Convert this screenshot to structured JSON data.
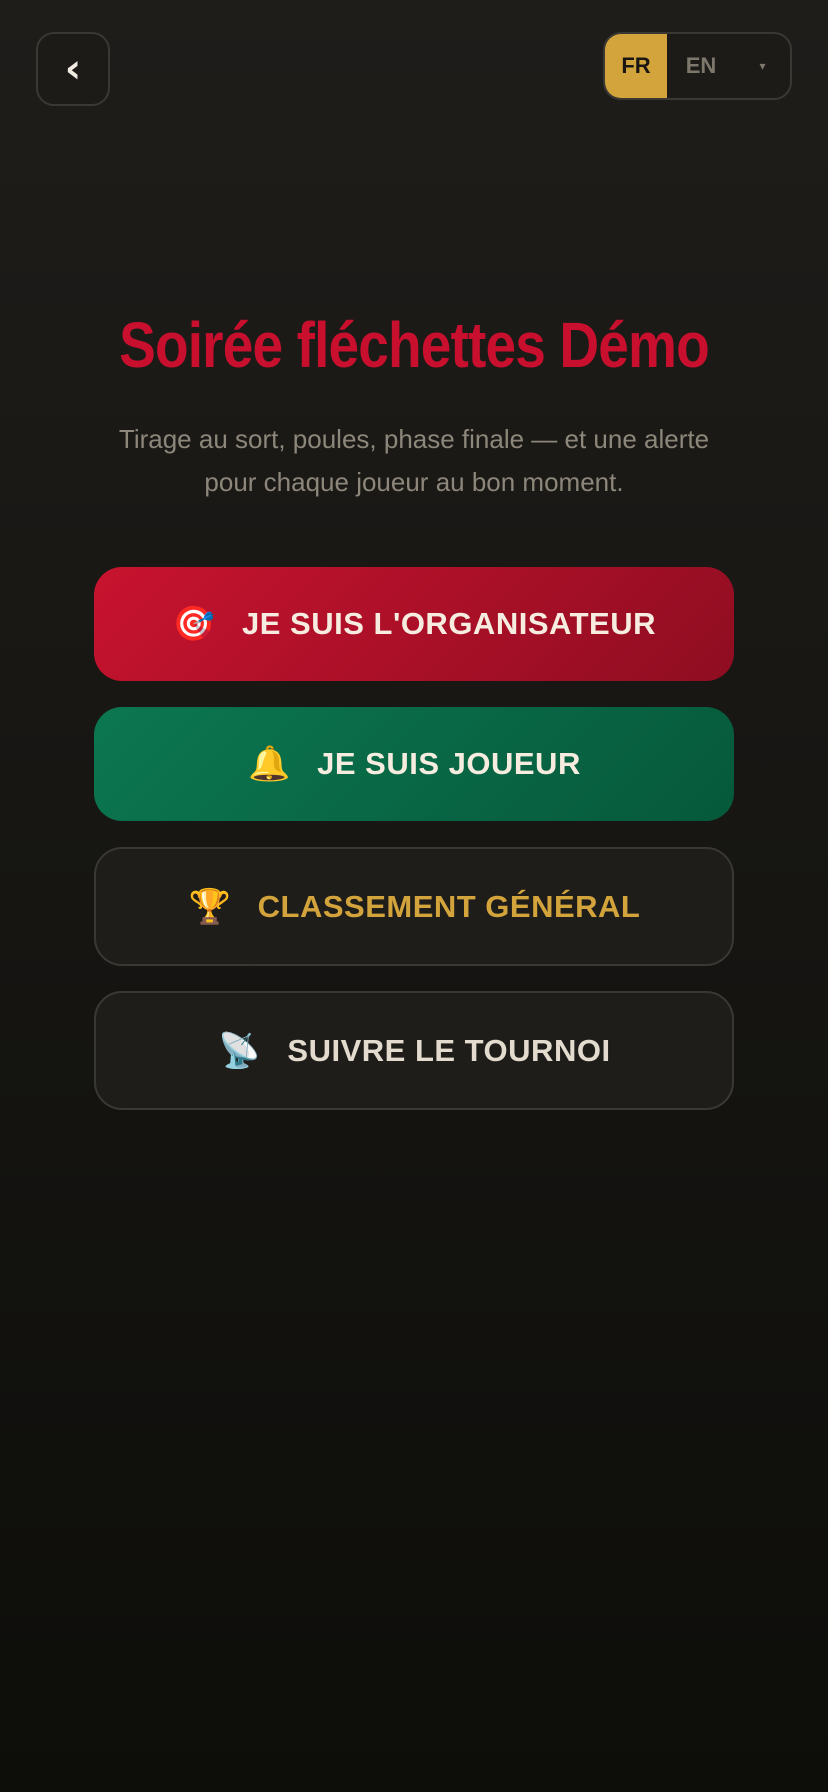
{
  "header": {
    "back_icon": "chevron-left-icon",
    "back_glyph": "‹",
    "language": {
      "options": [
        "FR",
        "EN"
      ],
      "selected": "FR",
      "selected_color": "#d4a43c",
      "dropdown_glyph": "▾"
    }
  },
  "hero": {
    "title": "Soirée fléchettes Démo",
    "title_color": "#c8102e",
    "subtitle": "Tirage au sort, poules, phase finale — et une alerte pour chaque joueur au bon moment."
  },
  "actions": [
    {
      "label": "Je suis l'organisateur",
      "icon": "dart-target-icon",
      "glyph": "🎯",
      "color": "#c8132f"
    },
    {
      "label": "Je suis joueur",
      "icon": "bell-icon",
      "glyph": "🔔",
      "color": "#0c7751"
    },
    {
      "label": "Classement général",
      "icon": "trophy-icon",
      "glyph": "🏆",
      "color": "#d4a43c"
    },
    {
      "label": "Suivre le tournoi",
      "icon": "satellite-dish-icon",
      "glyph": "📡",
      "color": "#e2dbce"
    }
  ]
}
